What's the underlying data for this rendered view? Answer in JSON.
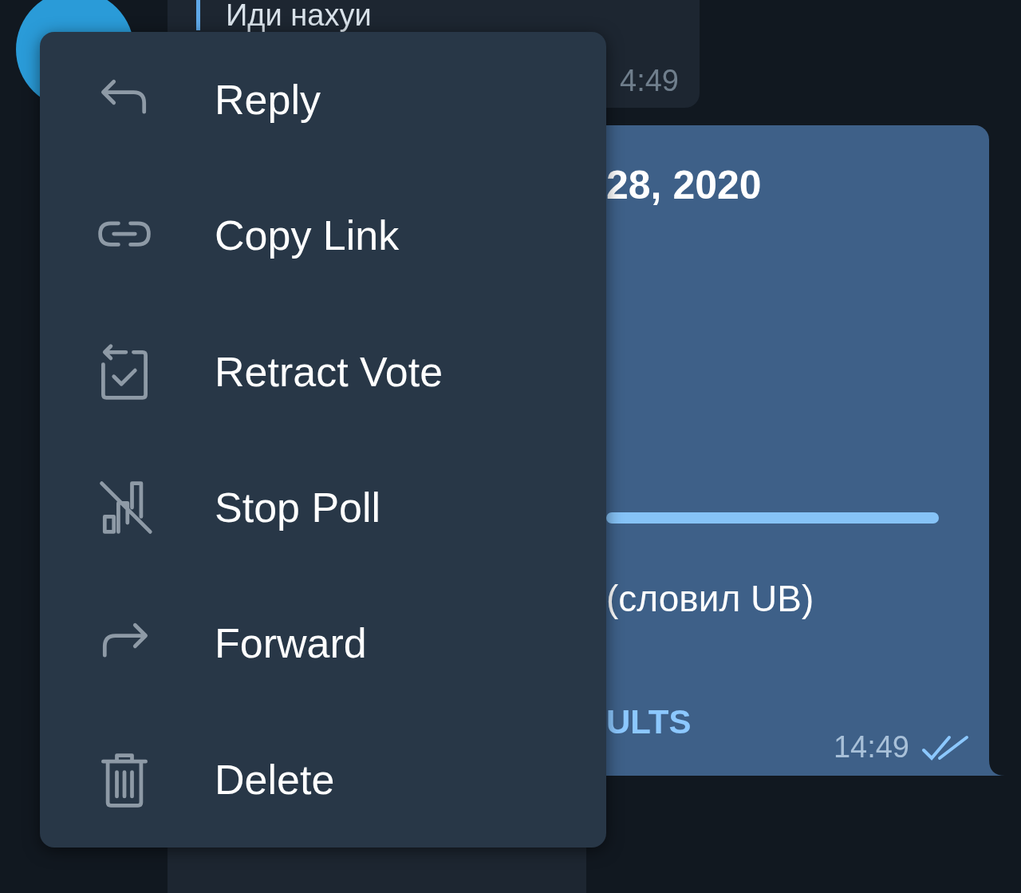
{
  "chat": {
    "incoming": {
      "reply_text": "Иди нахуи",
      "time": "4:49"
    },
    "poll": {
      "title": "28, 2020",
      "option_text": "(словил UB)",
      "results_button": "ULTS",
      "time": "14:49",
      "read": true
    }
  },
  "menu": {
    "items": [
      {
        "kind": "reply",
        "label": "Reply"
      },
      {
        "kind": "link",
        "label": "Copy Link"
      },
      {
        "kind": "retract",
        "label": "Retract Vote"
      },
      {
        "kind": "stop",
        "label": "Stop Poll"
      },
      {
        "kind": "forward",
        "label": "Forward"
      },
      {
        "kind": "delete",
        "label": "Delete"
      }
    ]
  }
}
